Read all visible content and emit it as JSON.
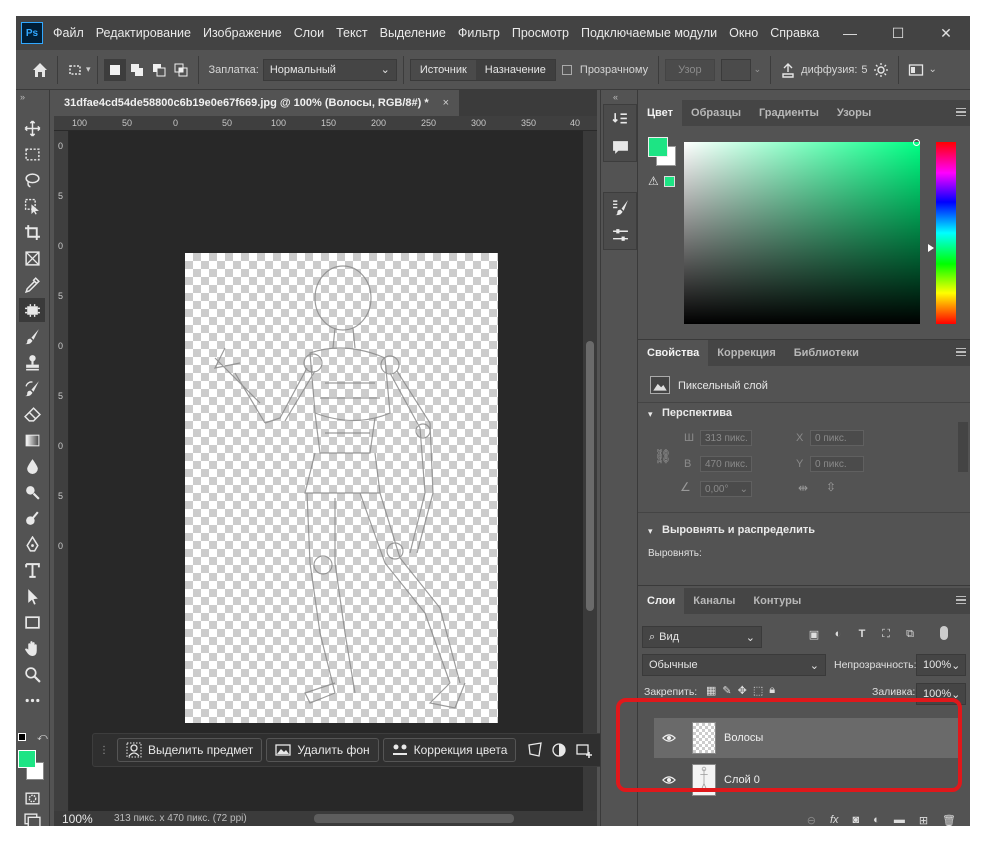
{
  "app": {
    "logo": "Ps"
  },
  "menu": [
    "Файл",
    "Редактирование",
    "Изображение",
    "Слои",
    "Текст",
    "Выделение",
    "Фильтр",
    "Просмотр",
    "Подключаемые модули",
    "Окно",
    "Справка"
  ],
  "window_controls": {
    "minimize": "—",
    "maximize": "☐",
    "close": "✕"
  },
  "options_bar": {
    "patch_label": "Заплатка:",
    "patch_mode": "Нормальный",
    "source_label": "Источник",
    "destination_label": "Назначение",
    "transparent_label": "Прозрачному",
    "pattern_label": "Узор",
    "diffusion_label": "диффузия:",
    "diffusion_value": "5"
  },
  "document": {
    "tab_title": "31dfae4cd54de58800c6b19e0e67f669.jpg @ 100% (Волосы, RGB/8#) *",
    "close_symbol": "×",
    "ruler_h": [
      "100",
      "50",
      "0",
      "50",
      "100",
      "150",
      "200",
      "250",
      "300",
      "350",
      "40"
    ],
    "ruler_v": [
      "0",
      "5",
      "0",
      "5",
      "0",
      "5",
      "0",
      "5",
      "0"
    ],
    "zoom": "100%",
    "size_info": "313 пикс. x 470 пикс. (72 ppi)"
  },
  "context_bar": {
    "select_subject": "Выделить предмет",
    "remove_bg": "Удалить фон",
    "color_correction": "Коррекция цвета"
  },
  "color_panel": {
    "tabs": [
      "Цвет",
      "Образцы",
      "Градиенты",
      "Узоры"
    ],
    "active_tab": "Цвет",
    "fg_color": "#1de484",
    "bg_color": "#ffffff"
  },
  "properties_panel": {
    "tabs": [
      "Свойства",
      "Коррекция",
      "Библиотеки"
    ],
    "layer_kind": "Пиксельный слой",
    "perspective_title": "Перспектива",
    "w_label": "Ш",
    "w_value": "313 пикс.",
    "h_label": "В",
    "h_value": "470 пикс.",
    "x_label": "X",
    "x_value": "0 пикс.",
    "y_label": "Y",
    "y_value": "0 пикс.",
    "angle_value": "0,00°",
    "align_title": "Выровнять и распределить",
    "align_label": "Выровнять:"
  },
  "layers_panel": {
    "tabs": [
      "Слои",
      "Каналы",
      "Контуры"
    ],
    "filter_label": "Вид",
    "blend_mode": "Обычные",
    "opacity_label": "Непрозрачность:",
    "opacity_value": "100%",
    "lock_label": "Закрепить:",
    "fill_label": "Заливка:",
    "fill_value": "100%",
    "layers": [
      {
        "name": "Волосы",
        "selected": true
      },
      {
        "name": "Слой 0",
        "selected": false
      }
    ],
    "fx_label": "fx"
  },
  "colors": {
    "highlight": "#e0181b",
    "accent_green": "#1de484"
  }
}
